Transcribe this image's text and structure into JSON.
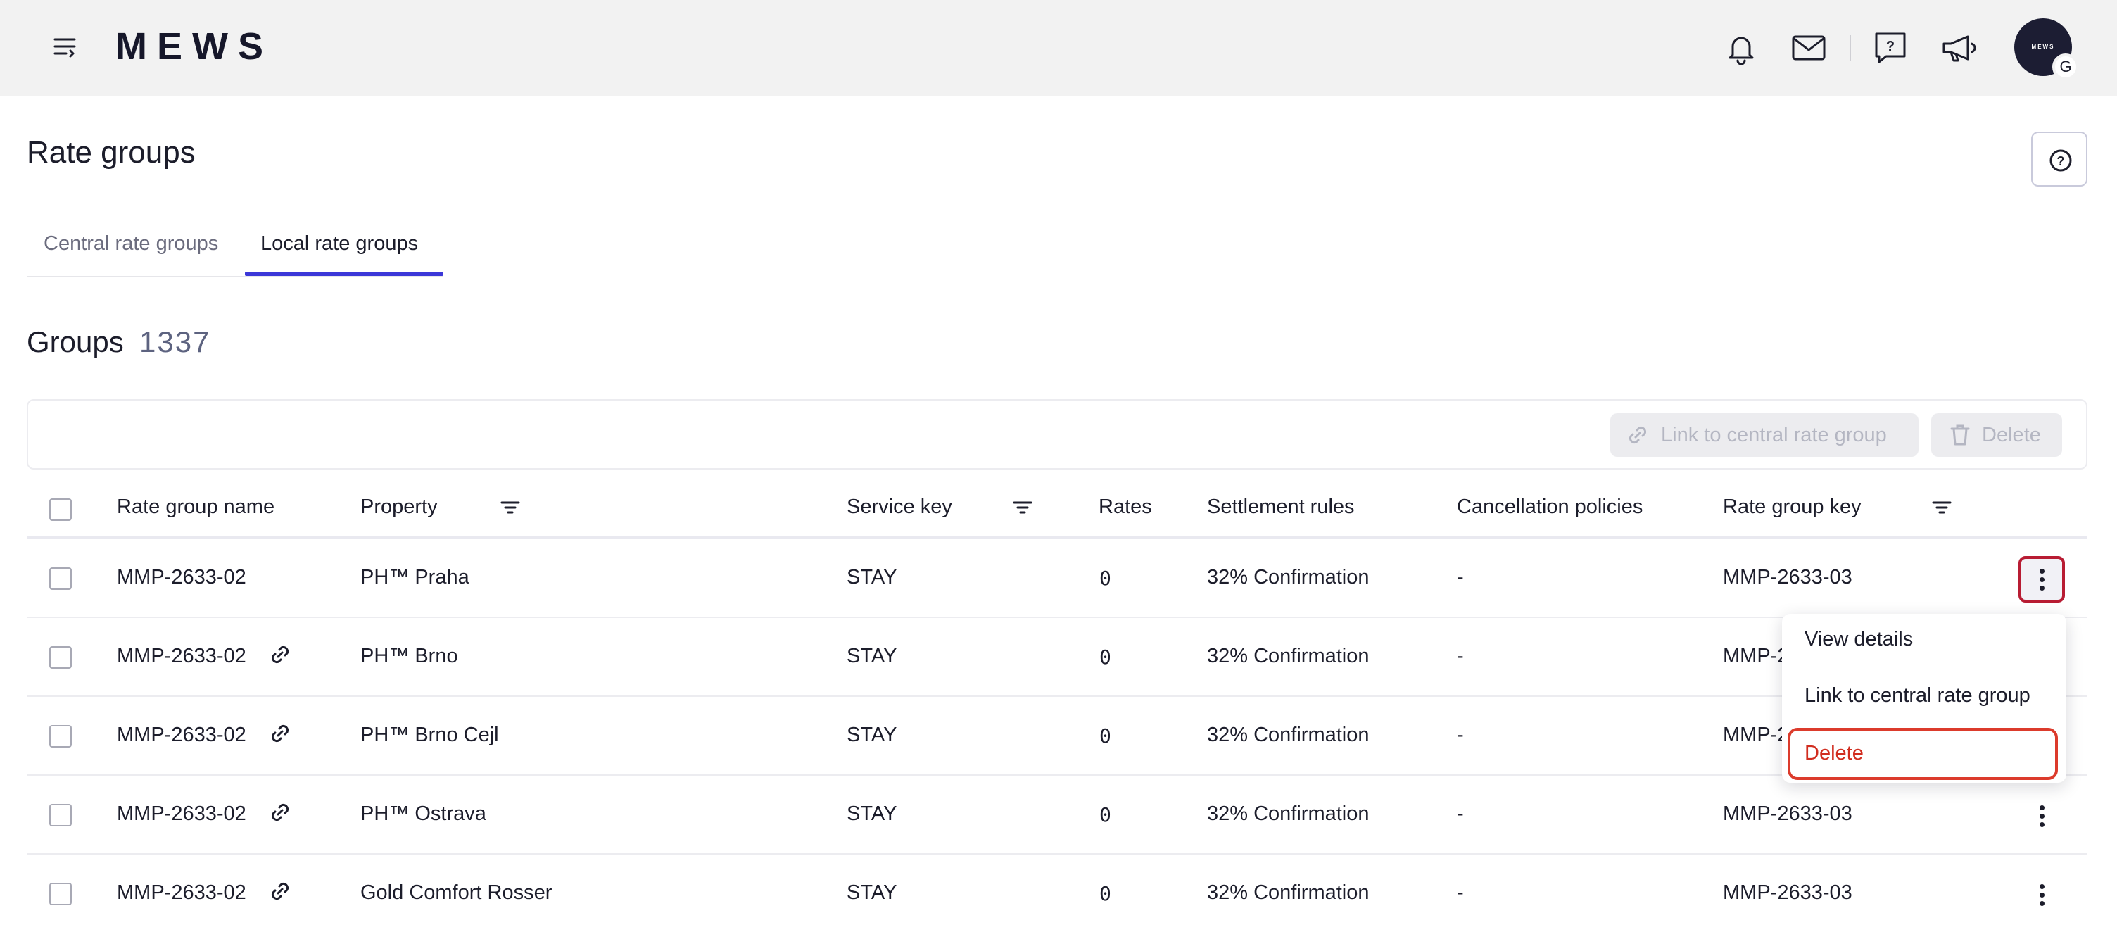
{
  "app": {
    "logo": "MEWS",
    "avatar_logo": "MEWS",
    "avatar_initial": "G"
  },
  "header": {
    "title": "Rate groups"
  },
  "tabs": [
    {
      "label": "Central rate groups",
      "active": false
    },
    {
      "label": "Local rate groups",
      "active": true
    }
  ],
  "groups": {
    "title": "Groups",
    "count": "1337"
  },
  "toolbar": {
    "link_label": "Link to central rate group",
    "delete_label": "Delete",
    "disabled": true
  },
  "table": {
    "columns": [
      "Rate group name",
      "Property",
      "Service key",
      "Rates",
      "Settlement rules",
      "Cancellation policies",
      "Rate group key"
    ],
    "rows": [
      {
        "name": "MMP-2633-02",
        "linked": false,
        "property": "PH™ Praha",
        "service_key": "STAY",
        "rates": "0",
        "settlement": "32% Confirmation",
        "cancellation": "-",
        "key": "MMP-2633-03"
      },
      {
        "name": "MMP-2633-02",
        "linked": true,
        "property": "PH™ Brno",
        "service_key": "STAY",
        "rates": "0",
        "settlement": "32% Confirmation",
        "cancellation": "-",
        "key": "MMP-2633-03"
      },
      {
        "name": "MMP-2633-02",
        "linked": true,
        "property": "PH™ Brno Cejl",
        "service_key": "STAY",
        "rates": "0",
        "settlement": "32% Confirmation",
        "cancellation": "-",
        "key": "MMP-2633-03"
      },
      {
        "name": "MMP-2633-02",
        "linked": true,
        "property": "PH™ Ostrava",
        "service_key": "STAY",
        "rates": "0",
        "settlement": "32% Confirmation",
        "cancellation": "-",
        "key": "MMP-2633-03"
      },
      {
        "name": "MMP-2633-02",
        "linked": true,
        "property": "Gold Comfort Rosser",
        "service_key": "STAY",
        "rates": "0",
        "settlement": "32% Confirmation",
        "cancellation": "-",
        "key": "MMP-2633-03"
      }
    ]
  },
  "menu": {
    "view_details": "View details",
    "link": "Link to central rate group",
    "delete": "Delete"
  },
  "colors": {
    "accent": "#3b37d8",
    "danger": "#d12d1f",
    "focus": "#b81c33"
  }
}
